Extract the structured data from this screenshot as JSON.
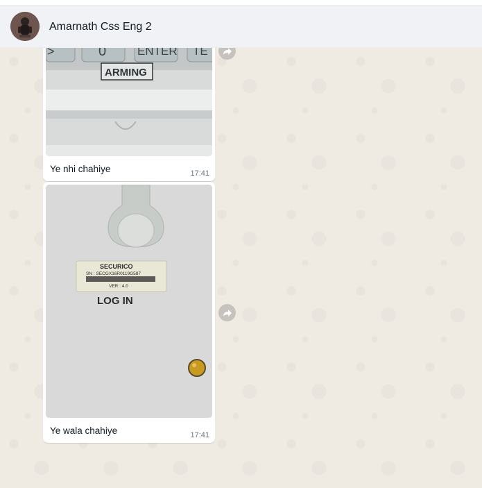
{
  "window": {
    "title": ""
  },
  "header": {
    "chat_name": "Amarnath Css Eng 2",
    "avatar_icon": "contact-avatar"
  },
  "messages": [
    {
      "image_description_labels": {
        "key_zero": "0",
        "key_enter": "ENTER",
        "key_partial": "TE",
        "panel_label": "ARMING"
      },
      "caption": "Ye nhi chahiye",
      "time": "17:41",
      "forward_icon": "forward-arrow-icon"
    },
    {
      "image_description_labels": {
        "brand": "SECURICO",
        "serial": "SN : SECGX16R0119G587",
        "version": "VER : 4.0",
        "button_label": "LOG IN"
      },
      "caption": "Ye wala chahiye",
      "time": "17:41",
      "forward_icon": "forward-arrow-icon"
    }
  ],
  "colors": {
    "chat_background": "#efeae2",
    "header_background": "#f0f2f5",
    "bubble_background": "#ffffff",
    "time_text": "#667781"
  }
}
